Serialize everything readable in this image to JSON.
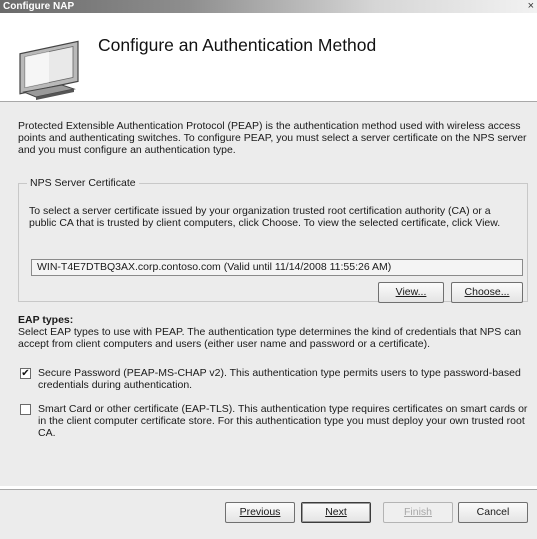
{
  "window": {
    "title": "Configure NAP",
    "close_glyph": "×"
  },
  "header": {
    "heading": "Configure an Authentication Method",
    "icon": "monitor-icon"
  },
  "intro_text": "Protected Extensible Authentication Protocol (PEAP) is the authentication method used with wireless access points and authenticating switches. To configure PEAP, you must select a server certificate on the NPS server and you must configure an authentication type.",
  "nps_cert": {
    "legend": "NPS Server Certificate",
    "description": "To select a server certificate issued by your organization trusted root certification authority (CA) or a public CA that is trusted by client computers, click Choose. To view the selected certificate, click View.",
    "certificate_value": "WIN-T4E7DTBQ3AX.corp.contoso.com (Valid until 11/14/2008 11:55:26 AM)",
    "view_label": "View...",
    "choose_label": "Choose..."
  },
  "eap": {
    "title": "EAP types:",
    "description": "Select EAP types to use with PEAP. The authentication type determines the kind of credentials that NPS can accept from client computers and users (either user name and password or a certificate).",
    "options": [
      {
        "label": "Secure Password (PEAP-MS-CHAP v2). This authentication type permits users to type password-based credentials during authentication.",
        "checked": true
      },
      {
        "label": "Smart Card or other certificate (EAP-TLS). This authentication type requires certificates on smart cards or in the client computer certificate store. For this authentication type you must deploy your own trusted root CA.",
        "checked": false
      }
    ]
  },
  "footer": {
    "previous": "Previous",
    "next": "Next",
    "finish": "Finish",
    "cancel": "Cancel"
  }
}
